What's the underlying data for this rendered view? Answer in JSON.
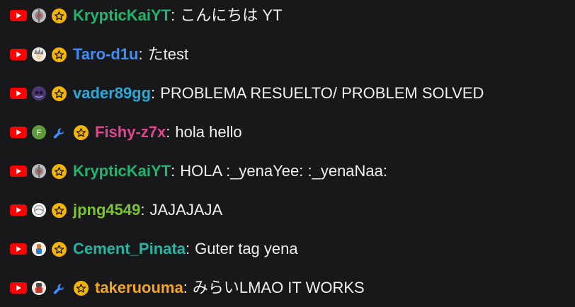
{
  "chat": {
    "messages": [
      {
        "username": "KrypticKaiYT",
        "name_color": "#22b46e",
        "text": "こんにちは YT",
        "avatar_icon": "robot-avatar-icon",
        "has_wrench_badge": false
      },
      {
        "username": "Taro-d1u",
        "name_color": "#3e8ef7",
        "text": "たtest",
        "avatar_icon": "anime-avatar-icon",
        "has_wrench_badge": false
      },
      {
        "username": "vader89gg",
        "name_color": "#2aa9d8",
        "text": "PROBLEMA RESUELTO/ PROBLEM SOLVED",
        "avatar_icon": "purple-avatar-icon",
        "has_wrench_badge": false
      },
      {
        "username": "Fishy-z7x",
        "name_color": "#e0458f",
        "text": "hola hello",
        "avatar_icon": "letter-f-avatar-icon",
        "avatar_letter": "F",
        "has_wrench_badge": true
      },
      {
        "username": "KrypticKaiYT",
        "name_color": "#22b46e",
        "text": "HOLA :_yenaYee: :_yenaNaa:",
        "avatar_icon": "robot-avatar-icon",
        "has_wrench_badge": false
      },
      {
        "username": "jpng4549",
        "name_color": "#7ac52e",
        "text": "JAJAJAJA",
        "avatar_icon": "white-avatar-icon",
        "has_wrench_badge": false
      },
      {
        "username": "Cement_Pinata",
        "name_color": "#26b3a0",
        "text": "Guter tag yena",
        "avatar_icon": "character-avatar-icon",
        "has_wrench_badge": false
      },
      {
        "username": "takeruouma",
        "name_color": "#f2a61f",
        "text": "みらいLMAO IT WORKS",
        "avatar_icon": "red-character-avatar-icon",
        "has_wrench_badge": true
      }
    ]
  },
  "colors": {
    "background": "#18181b",
    "text": "#efeff1",
    "youtube_red": "#ff0000",
    "star_badge": "#f5b400",
    "wrench_badge": "#3e8ef7"
  }
}
